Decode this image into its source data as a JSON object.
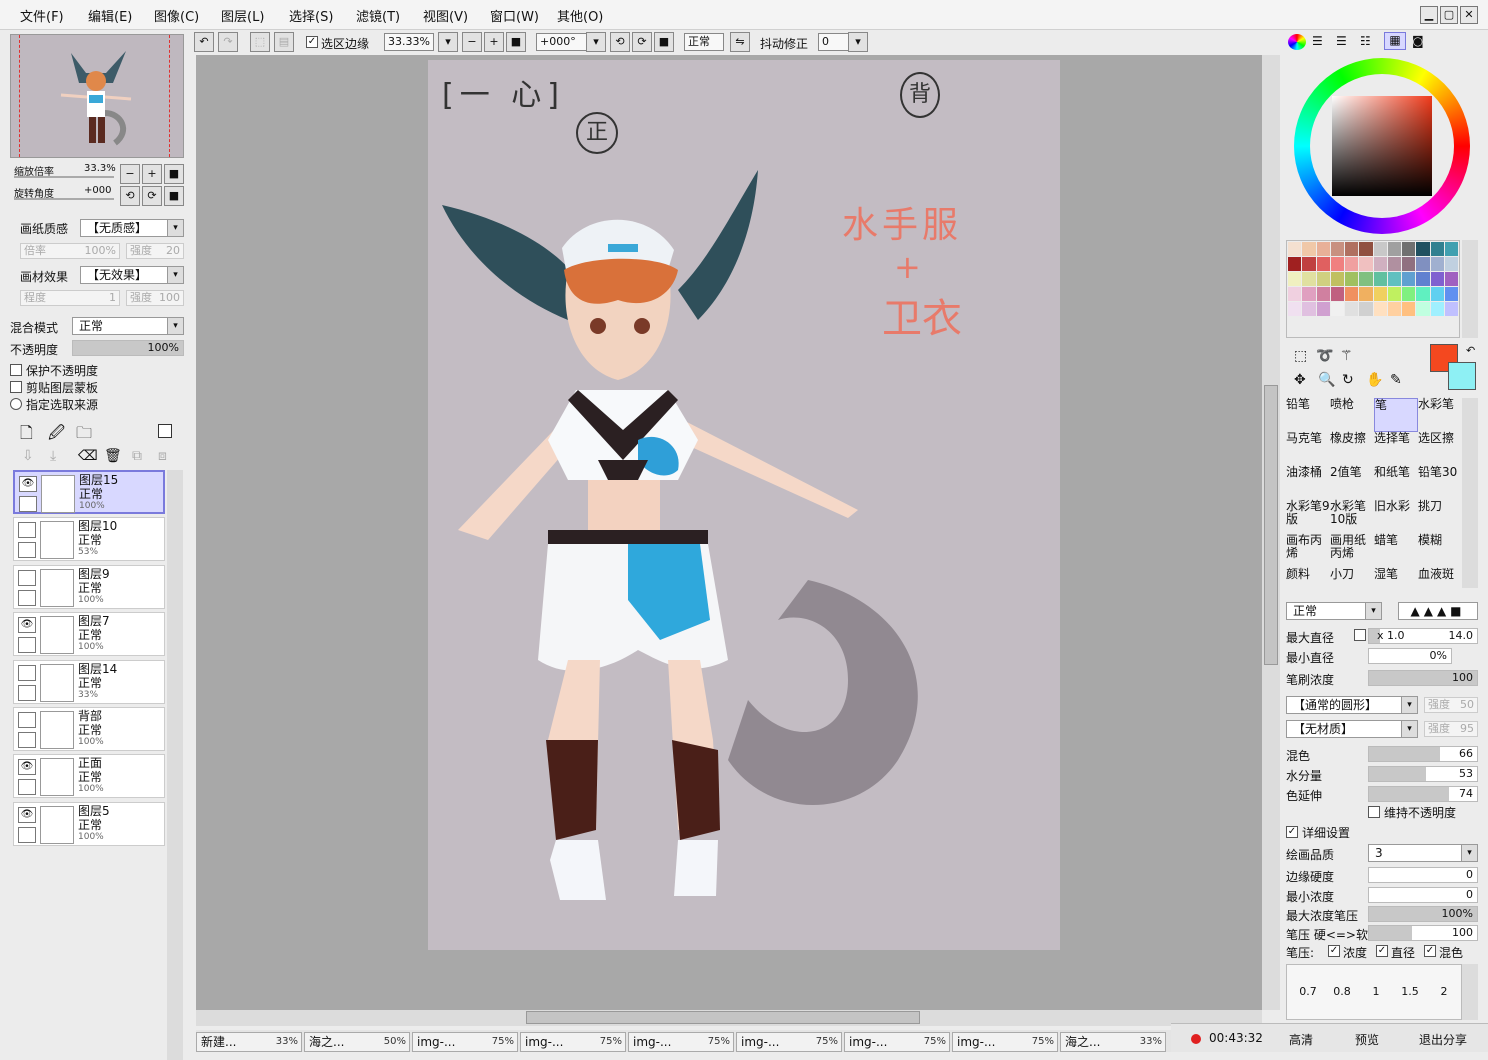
{
  "menu": [
    "文件(F)",
    "编辑(E)",
    "图像(C)",
    "图层(L)",
    "选择(S)",
    "滤镜(T)",
    "视图(V)",
    "窗口(W)",
    "其他(O)"
  ],
  "toolbar": {
    "select_edge": "选区边缘",
    "zoom": "33.33%",
    "rotation": "+000°",
    "blend": "正常",
    "stabilizer_label": "抖动修正",
    "stabilizer_value": "0"
  },
  "navigator": {
    "zoom_label": "缩放倍率",
    "zoom_value": "33.3%",
    "angle_label": "旋转角度",
    "angle_value": "+000"
  },
  "paper": {
    "label": "画纸质感",
    "value": "【无质感】",
    "scale_label": "倍率",
    "scale_value": "100%",
    "strength_label": "强度",
    "strength_value": "20"
  },
  "effect": {
    "label": "画材效果",
    "value": "【无效果】",
    "degree_label": "程度",
    "degree_value": "1",
    "strength_label": "强度",
    "strength_value": "100"
  },
  "blend": {
    "label": "混合模式",
    "value": "正常"
  },
  "opacity": {
    "label": "不透明度",
    "value": "100%"
  },
  "options": [
    "保护不透明度",
    "剪贴图层蒙板",
    "指定选取来源"
  ],
  "layers": [
    {
      "name": "图层15",
      "mode": "正常",
      "opacity": "100%",
      "visible": true,
      "selected": true
    },
    {
      "name": "图层10",
      "mode": "正常",
      "opacity": "53%",
      "visible": false,
      "selected": false
    },
    {
      "name": "图层9",
      "mode": "正常",
      "opacity": "100%",
      "visible": false,
      "selected": false
    },
    {
      "name": "图层7",
      "mode": "正常",
      "opacity": "100%",
      "visible": true,
      "selected": false
    },
    {
      "name": "图层14",
      "mode": "正常",
      "opacity": "33%",
      "visible": false,
      "selected": false
    },
    {
      "name": "背部",
      "mode": "正常",
      "opacity": "100%",
      "visible": false,
      "selected": false
    },
    {
      "name": "正面",
      "mode": "正常",
      "opacity": "100%",
      "visible": true,
      "selected": false
    },
    {
      "name": "图层5",
      "mode": "正常",
      "opacity": "100%",
      "visible": true,
      "selected": false
    }
  ],
  "canvas_text": {
    "title": "[一 心]",
    "front": "正",
    "back": "背",
    "note1": "水手服",
    "note2": "+",
    "note3": "卫衣"
  },
  "brushes": [
    [
      "铅笔",
      "喷枪",
      "笔",
      "水彩笔"
    ],
    [
      "马克笔",
      "橡皮擦",
      "选择笔",
      "选区擦"
    ],
    [
      "油漆桶",
      "2值笔",
      "和纸笔",
      "铅笔30"
    ],
    [
      "水彩笔9版",
      "水彩笔10版",
      "旧水彩",
      "挑刀"
    ],
    [
      "画布丙烯",
      "画用纸丙烯",
      "蜡笔",
      "模糊"
    ],
    [
      "颜料",
      "小刀",
      "湿笔",
      "血液斑"
    ]
  ],
  "brush_mode": "正常",
  "brush_settings": {
    "max_size_label": "最大直径",
    "max_size_mult": "x 1.0",
    "max_size_value": "14.0",
    "min_size_label": "最小直径",
    "min_size_value": "0%",
    "density_label": "笔刷浓度",
    "density_value": "100",
    "shape": "【通常的圆形】",
    "shape_strength_label": "强度",
    "shape_strength": "50",
    "texture": "【无材质】",
    "texture_strength_label": "强度",
    "texture_strength": "95",
    "mix_label": "混色",
    "mix_value": "66",
    "water_label": "水分量",
    "water_value": "53",
    "stretch_label": "色延伸",
    "stretch_value": "74",
    "keep_opacity": "维持不透明度",
    "detail": "详细设置",
    "quality_label": "绘画品质",
    "quality_value": "3",
    "edge_label": "边缘硬度",
    "edge_value": "0",
    "min_density_label": "最小浓度",
    "min_density_value": "0",
    "max_pressure_label": "最大浓度笔压",
    "max_pressure_value": "100%",
    "hardness_label": "笔压 硬<=>软",
    "hardness_value": "100",
    "pressure_label": "笔压:",
    "pressure_opts": [
      "浓度",
      "直径",
      "混色"
    ]
  },
  "size_presets": [
    "0.7",
    "0.8",
    "1",
    "1.5",
    "2"
  ],
  "taskbar": [
    {
      "name": "新建...",
      "pct": "33%"
    },
    {
      "name": "海之...",
      "pct": "50%"
    },
    {
      "name": "img-...",
      "pct": "75%"
    },
    {
      "name": "img-...",
      "pct": "75%"
    },
    {
      "name": "img-...",
      "pct": "75%"
    },
    {
      "name": "img-...",
      "pct": "75%"
    },
    {
      "name": "img-...",
      "pct": "75%"
    },
    {
      "name": "img-...",
      "pct": "75%"
    },
    {
      "name": "海之...",
      "pct": "33%"
    }
  ],
  "status": {
    "time": "00:43:32",
    "hd": "高清",
    "preview": "预览",
    "share": "退出分享"
  },
  "colors": {
    "primary": "#f4481f",
    "secondary": "#8ef0f4",
    "accent": "#7a7adc"
  }
}
